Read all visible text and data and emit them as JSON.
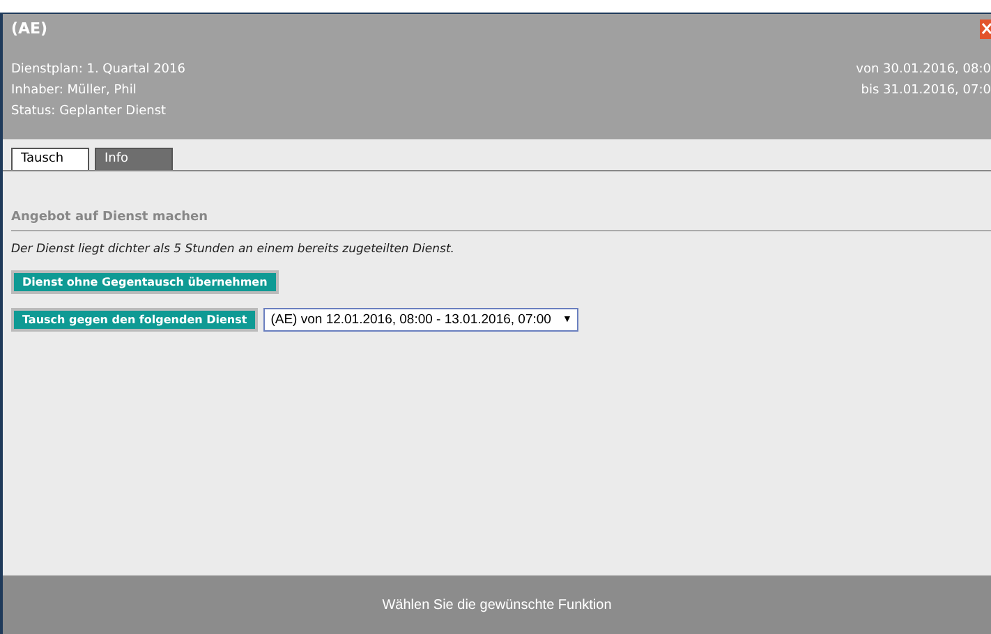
{
  "window": {
    "title": "(AE)"
  },
  "header": {
    "left": [
      "Dienstplan: 1. Quartal 2016",
      "Inhaber: Müller, Phil",
      "Status: Geplanter Dienst"
    ],
    "right": [
      "von 30.01.2016, 08:0",
      "bis 31.01.2016, 07:0"
    ]
  },
  "tabs": [
    {
      "label": "Tausch",
      "selected": true
    },
    {
      "label": "Info",
      "selected": false
    }
  ],
  "section": {
    "heading": "Angebot auf Dienst machen",
    "notice": "Der Dienst liegt dichter als 5 Stunden an einem bereits zugeteilten Dienst."
  },
  "buttons": [
    "Dienst ohne Gegentausch übernehmen",
    "Tausch gegen den folgenden Dienst"
  ],
  "select": {
    "value": "(AE) von 12.01.2016, 08:00 - 13.01.2016, 07:00",
    "arrow": "▼"
  },
  "footer": "Wählen Sie die gewünschte Funktion"
}
